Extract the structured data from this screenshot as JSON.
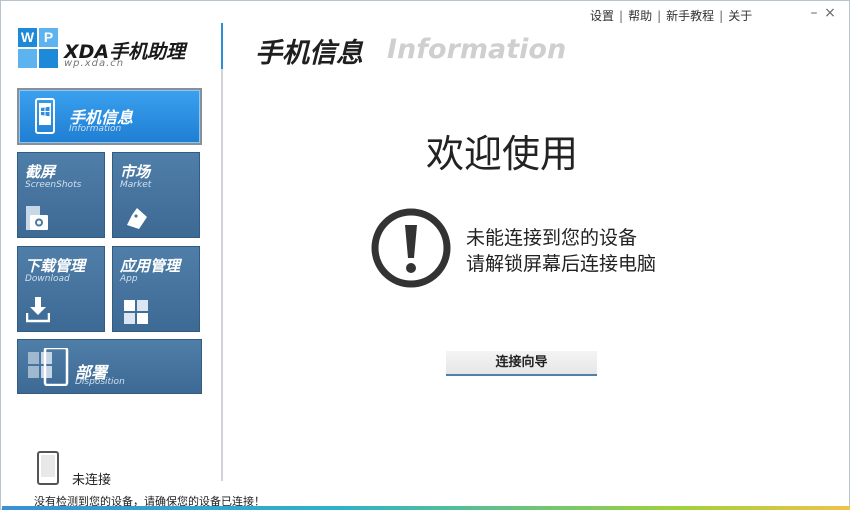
{
  "top_links": {
    "settings": "设置",
    "help": "帮助",
    "tutorial": "新手教程",
    "about": "关于",
    "separator": "|"
  },
  "window_controls": {
    "minimize": "–",
    "close": "×"
  },
  "logo": {
    "letters": [
      "W",
      "P",
      "",
      ""
    ],
    "title": "XDA手机助理",
    "subtitle": "wp.xda.cn"
  },
  "sidebar": {
    "tiles": [
      {
        "title": "手机信息",
        "subtitle": "Information",
        "active": true,
        "icon": "windows-phone-icon"
      },
      {
        "title": "截屏",
        "subtitle": "ScreenShots",
        "active": false,
        "icon": "camera-icon"
      },
      {
        "title": "市场",
        "subtitle": "Market",
        "active": false,
        "icon": "shopping-bag-icon"
      },
      {
        "title": "下载管理",
        "subtitle": "Download",
        "active": false,
        "icon": "download-icon"
      },
      {
        "title": "应用管理",
        "subtitle": "App",
        "active": false,
        "icon": "app-grid-icon"
      },
      {
        "title": "部署",
        "subtitle": "Disposition",
        "active": false,
        "icon": "deploy-icon"
      }
    ],
    "connection_status": "未连接"
  },
  "main": {
    "title": "手机信息",
    "title_en": "Information",
    "welcome": "欢迎使用",
    "message_line1": "未能连接到您的设备",
    "message_line2": "请解锁屏幕后连接电脑",
    "wizard_button": "连接向导"
  },
  "status_bar": {
    "message": "没有检测到您的设备，请确保您的设备已连接！"
  },
  "colors": {
    "accent": "#2a8fd6",
    "tile": "#4a78a2",
    "tile_active": "#2b8de0",
    "logo_blue": "#1e88d9",
    "logo_lightblue": "#5cb3ef"
  }
}
